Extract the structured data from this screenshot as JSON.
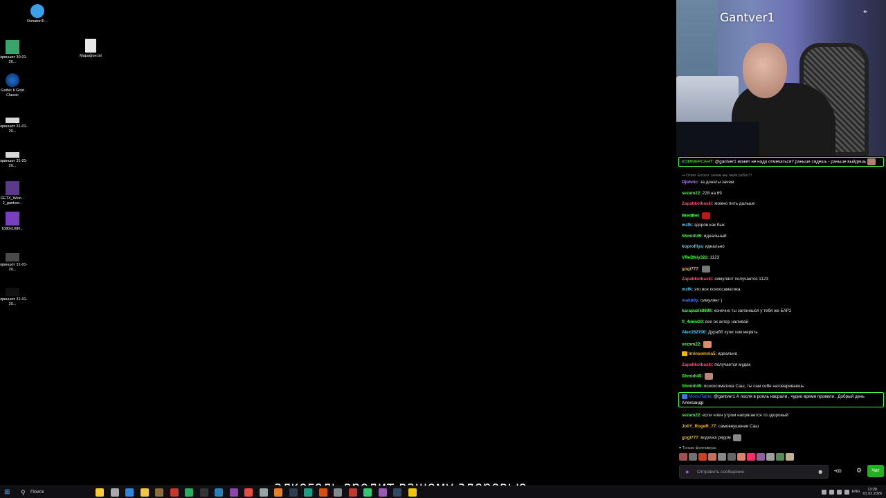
{
  "desktop": {
    "icons": [
      {
        "label": "DonatonTi...",
        "color": "#3aa0e8"
      },
      {
        "label": "Скриншот 30-01-20...",
        "color": "#3aa56a"
      },
      {
        "label": "Марафон.txt",
        "color": "#e8e8e8"
      },
      {
        "label": "Gothic II Gold Classic",
        "color": "#1e6fd0"
      },
      {
        "label": "Скриншот 31-01-20...",
        "color": "#d8d8d8"
      },
      {
        "label": "Скриншот 31-01-20...",
        "color": "#d8d8d8"
      },
      {
        "label": "GETX_Welc... 2_gantver...",
        "color": "#5a3b8a"
      },
      {
        "label": "1080x1080...",
        "color": "#7a3fbf"
      },
      {
        "label": "Скриншот 31-01-20...",
        "color": "#4a4a4a"
      },
      {
        "label": "Скриншот 31-01-20...",
        "color": "#111111"
      }
    ]
  },
  "webcam": {
    "streamer_name": "Gantver1"
  },
  "chat": {
    "top_highlight": {
      "user": "КОММЕРСАНТ",
      "user_color": "#3fff3f",
      "text": ": @gantver1 может не надо отмечаться? раньше сядешь - раньше выйдешь"
    },
    "reply_context": "↪ Ответ Ernam: зачем мы пили ребят?!",
    "messages": [
      {
        "user": "Djohnic",
        "color": "#b87cff",
        "text": ": за донаты зачем"
      },
      {
        "user": "sezam22",
        "color": "#3fff3f",
        "text": ": 228 на 69"
      },
      {
        "user": "Zapahkolbaski",
        "color": "#ff4f7a",
        "text": ": можно пить дальше"
      },
      {
        "user": "BredBet",
        "color": "#3fff3f",
        "text": ":",
        "emote": "#c01616"
      },
      {
        "user": "mzfk",
        "color": "#4fd2ff",
        "text": ": здоров как бык"
      },
      {
        "user": "Shmidt45",
        "color": "#3fff3f",
        "text": ": идеальный"
      },
      {
        "user": "koprofilya",
        "color": "#4fd2ff",
        "text": ": идеально"
      },
      {
        "user": "VReDNiy322",
        "color": "#3fff3f",
        "text": ": 1123"
      },
      {
        "user": "gogi777",
        "color": "#f2b705",
        "text": ":",
        "emote": "#777777"
      },
      {
        "user": "Zapahkolbaski",
        "color": "#ff4f7a",
        "text": ": симулянт получается 1123"
      },
      {
        "user": "mzfk",
        "color": "#4fd2ff",
        "text": ": это все психосаматика"
      },
      {
        "user": "makb0y",
        "color": "#4a7bff",
        "text": ": симулянт )"
      },
      {
        "user": "karapuzik8698",
        "color": "#3fff3f",
        "text": ": конечно ты загонишся у тебя же БАР2"
      },
      {
        "user": "fl_4minG0",
        "color": "#3fff3f",
        "text": ": все ок актер наливай"
      },
      {
        "user": "Alex152700",
        "color": "#4fd2ff",
        "text": ": Дурабб хули тем мерять"
      },
      {
        "user": "sezam22",
        "color": "#3fff3f",
        "text": ":",
        "emote": "#e08a6a"
      },
      {
        "user": "lminsomnia5",
        "color": "#f2b705",
        "text": ": идеально",
        "badge": true
      },
      {
        "user": "Zapahkolbaski",
        "color": "#ff4f7a",
        "text": ": получается мудак"
      },
      {
        "user": "Shmidt45",
        "color": "#3fff3f",
        "text": ":",
        "emote": "#b8897a"
      },
      {
        "user": "Shmidt45",
        "color": "#3fff3f",
        "text": ": психосоматика Саш, ты сам себе наговариваешь"
      }
    ],
    "bottom_highlight": {
      "user": "MorsdTable",
      "user_color": "#4a7bff",
      "text": ": @gantver1 А посля в рояль насрали , чудно время провели . Добрый день Александр"
    },
    "messages2": [
      {
        "user": "sezam22",
        "color": "#3fff3f",
        "text": ": если член утром напрягается то здоровый"
      },
      {
        "user": "JollY_RogeR_77",
        "color": "#f2b705",
        "text": ": самовнушение Саш"
      },
      {
        "user": "gogi777",
        "color": "#f2b705",
        "text": ": водочка рядом",
        "emote": "#888888"
      }
    ],
    "followers_only": "♥ Только фолловеры",
    "emote_colors": [
      "#a05050",
      "#707070",
      "#d04020",
      "#c86f5a",
      "#888",
      "#666",
      "#e0806a",
      "#ff2a6a",
      "#9060a0",
      "#a0a0a0",
      "#5a8a5a",
      "#c0b090"
    ],
    "input_placeholder": "Отправить сообщение",
    "send_label": "Чат",
    "points": "•ꝏ"
  },
  "taskbar": {
    "search_label": "Поиск",
    "subtitle": "алкоголь вредит вашему здоровью",
    "icon_colors": [
      "#ffcc33",
      "#aaaaaa",
      "#2e86de",
      "#f5c542",
      "#8a6d3b",
      "#c0392b",
      "#27ae60",
      "#333333",
      "#2980b9",
      "#8e44ad",
      "#e74c3c",
      "#95a5a6",
      "#e67e22",
      "#2c3e50",
      "#16a085",
      "#d35400",
      "#7f8c8d",
      "#c0392b",
      "#2ecc71",
      "#9b59b6",
      "#34495e",
      "#f1c40f"
    ],
    "lang": "ENG",
    "time": "13:28",
    "date": "01.02.2026"
  }
}
